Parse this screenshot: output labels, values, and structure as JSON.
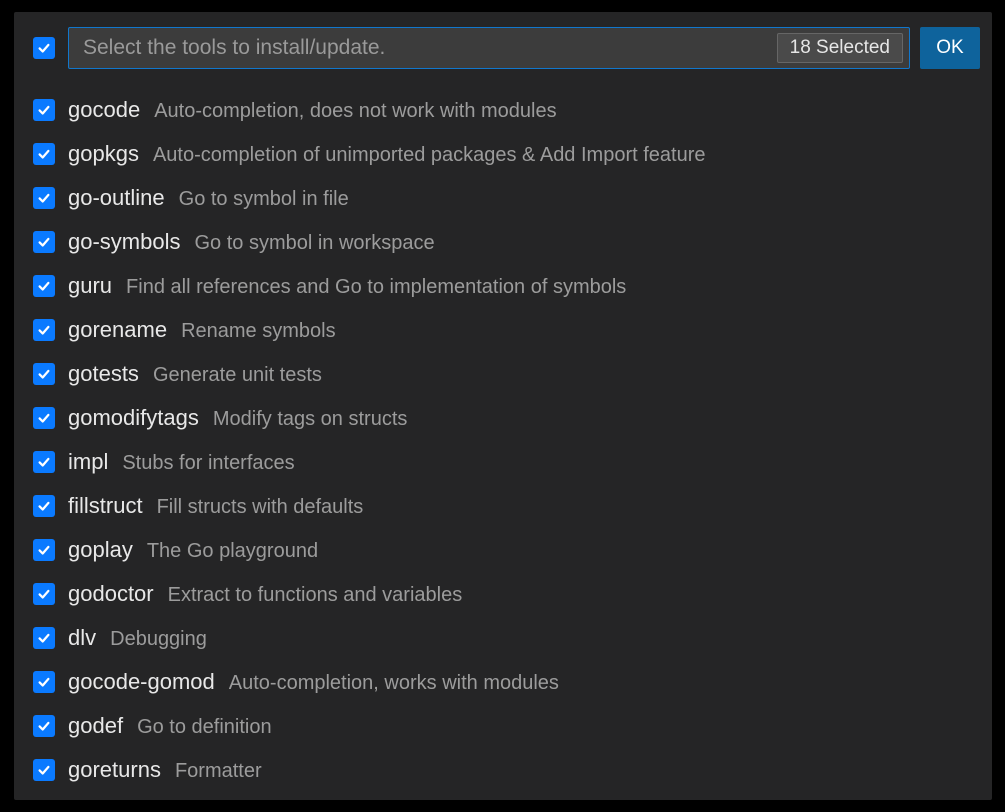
{
  "header": {
    "placeholder": "Select the tools to install/update.",
    "selected_badge": "18 Selected",
    "ok_label": "OK"
  },
  "tools": [
    {
      "name": "gocode",
      "desc": "Auto-completion, does not work with modules"
    },
    {
      "name": "gopkgs",
      "desc": "Auto-completion of unimported packages & Add Import feature"
    },
    {
      "name": "go-outline",
      "desc": "Go to symbol in file"
    },
    {
      "name": "go-symbols",
      "desc": "Go to symbol in workspace"
    },
    {
      "name": "guru",
      "desc": "Find all references and Go to implementation of symbols"
    },
    {
      "name": "gorename",
      "desc": "Rename symbols"
    },
    {
      "name": "gotests",
      "desc": "Generate unit tests"
    },
    {
      "name": "gomodifytags",
      "desc": "Modify tags on structs"
    },
    {
      "name": "impl",
      "desc": "Stubs for interfaces"
    },
    {
      "name": "fillstruct",
      "desc": "Fill structs with defaults"
    },
    {
      "name": "goplay",
      "desc": "The Go playground"
    },
    {
      "name": "godoctor",
      "desc": "Extract to functions and variables"
    },
    {
      "name": "dlv",
      "desc": "Debugging"
    },
    {
      "name": "gocode-gomod",
      "desc": "Auto-completion, works with modules"
    },
    {
      "name": "godef",
      "desc": "Go to definition"
    },
    {
      "name": "goreturns",
      "desc": "Formatter"
    }
  ]
}
